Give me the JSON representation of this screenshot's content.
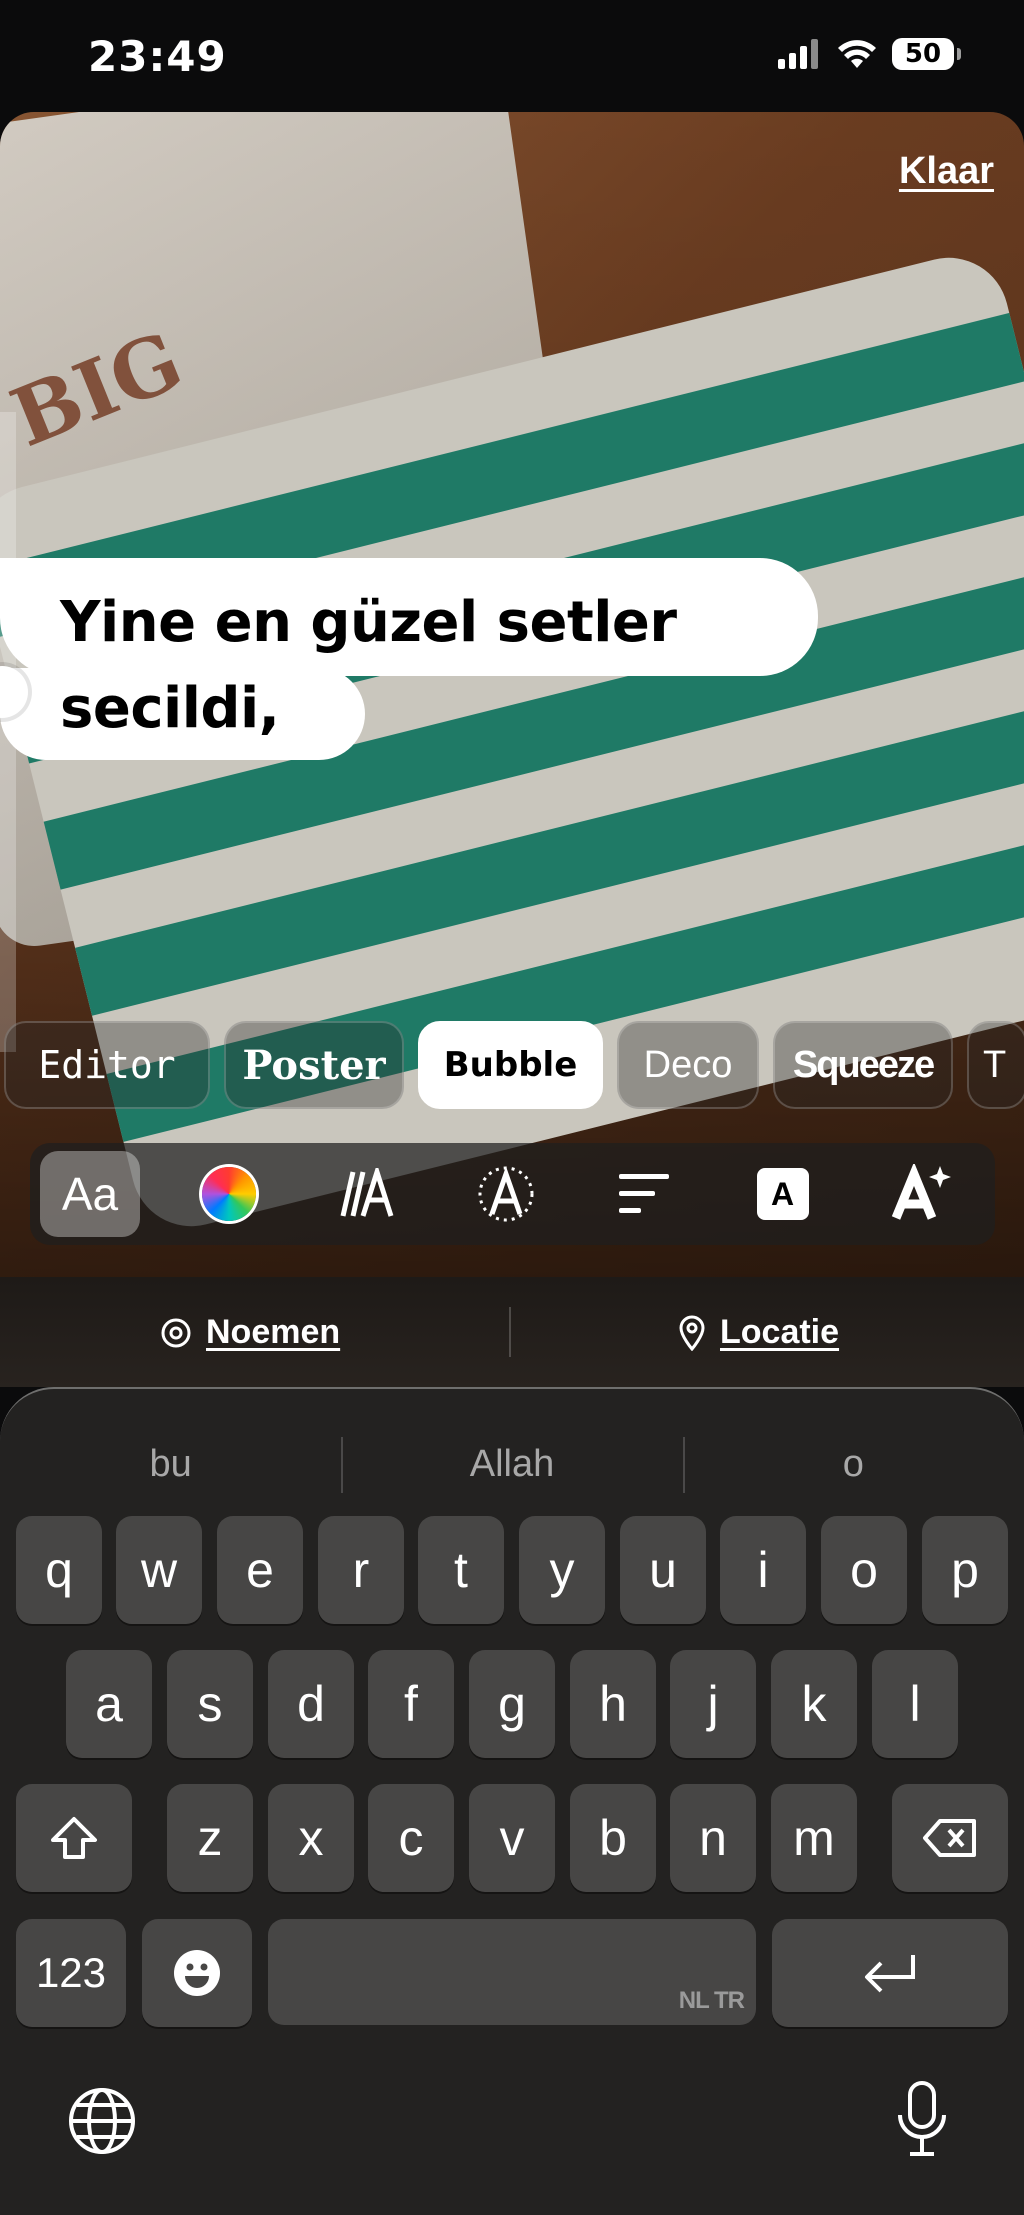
{
  "status_bar": {
    "time": "23:49",
    "battery": "50"
  },
  "editor": {
    "done_label": "Klaar",
    "text_lines": [
      "Yine en güzel setler",
      "secildi,"
    ],
    "photo_text": "BIG"
  },
  "font_styles": [
    {
      "label": "Editor",
      "selected": false
    },
    {
      "label": "Poster",
      "selected": false
    },
    {
      "label": "Bubble",
      "selected": true
    },
    {
      "label": "Deco",
      "selected": false
    },
    {
      "label": "Squeeze",
      "selected": false
    },
    {
      "label": "T",
      "selected": false
    }
  ],
  "toolbar": {
    "font_label": "Aa",
    "tools": [
      "font-icon",
      "color-wheel-icon",
      "italic-animation-icon",
      "text-effect-icon",
      "align-left-icon",
      "text-background-icon",
      "sparkle-text-icon"
    ],
    "background_letter": "A"
  },
  "actions": {
    "mention": "Noemen",
    "location": "Locatie"
  },
  "keyboard": {
    "suggestions": [
      "bu",
      "Allah",
      "o"
    ],
    "row1": [
      "q",
      "w",
      "e",
      "r",
      "t",
      "y",
      "u",
      "i",
      "o",
      "p"
    ],
    "row2": [
      "a",
      "s",
      "d",
      "f",
      "g",
      "h",
      "j",
      "k",
      "l"
    ],
    "row3": [
      "z",
      "x",
      "c",
      "v",
      "b",
      "n",
      "m"
    ],
    "numbers_label": "123",
    "languages_label": "NL TR",
    "colors": {
      "key": "#474645",
      "keyboard_bg": "#232221"
    }
  }
}
